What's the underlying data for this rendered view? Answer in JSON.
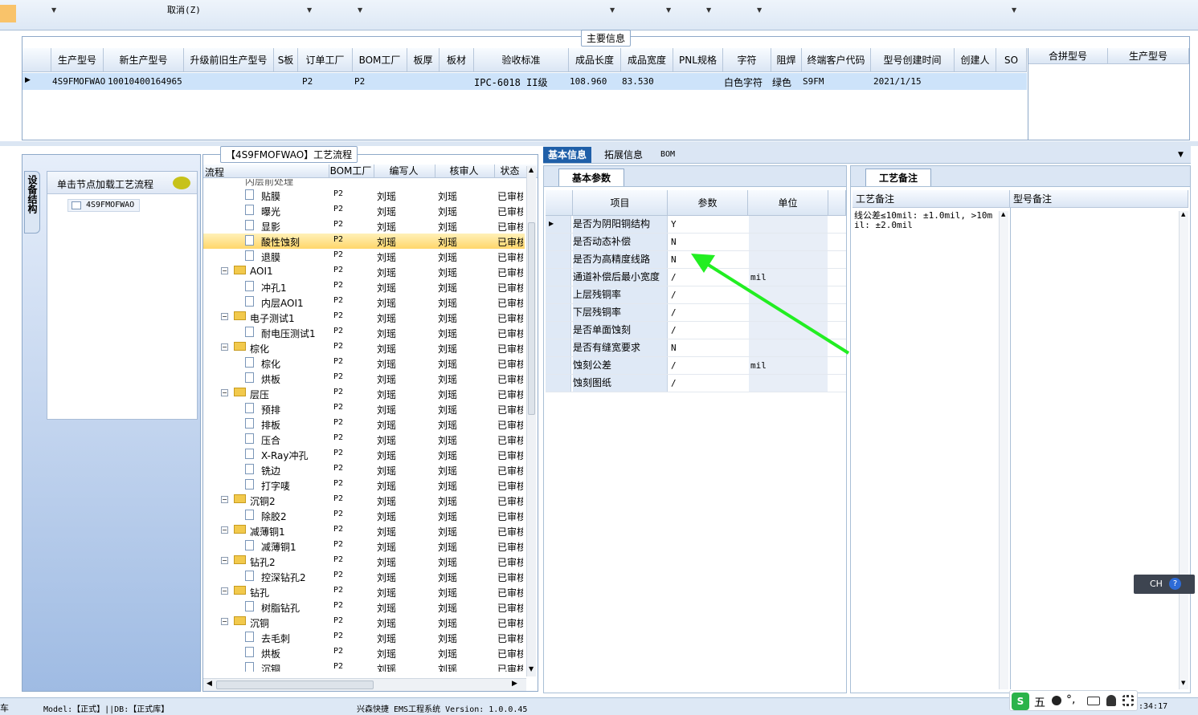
{
  "toolbar": {
    "cancel_label": "取消(Z)"
  },
  "main_info": {
    "legend": "主要信息",
    "columns": [
      "生产型号",
      "新生产型号",
      "升级前旧生产型号",
      "S板",
      "订单工厂",
      "BOM工厂",
      "板厚",
      "板材",
      "验收标准",
      "成品长度",
      "成品宽度",
      "PNL规格",
      "字符",
      "阻焊",
      "终端客户代码",
      "型号创建时间",
      "创建人",
      "SO"
    ],
    "row": {
      "生产型号": "4S9FMOFWAO",
      "新生产型号": "10010400164965",
      "订单工厂": "P2",
      "BOM工厂": "P2",
      "验收标准": "IPC-6018 II级",
      "成品长度": "108.960",
      "成品宽度": "83.530",
      "字符": "白色字符",
      "阻焊": "绿色",
      "终端客户代码": "S9FM",
      "型号创建时间": "2021/1/15"
    },
    "merge_columns": [
      "合拼型号",
      "生产型号"
    ]
  },
  "left_panel": {
    "vertical_tab": "设备结构",
    "header": "单击节点加载工艺流程",
    "tree_node": "4S9FMOFWAO"
  },
  "flow": {
    "legend": "【4S9FMOFWAO】工艺流程",
    "columns": [
      "流程",
      "BOM工厂",
      "编写人",
      "核审人",
      "状态"
    ],
    "partial_top": "内层前处理",
    "rows": [
      {
        "name": "贴膜",
        "type": "doc"
      },
      {
        "name": "曝光",
        "type": "doc"
      },
      {
        "name": "显影",
        "type": "doc"
      },
      {
        "name": "酸性蚀刻",
        "type": "doc",
        "selected": true
      },
      {
        "name": "退膜",
        "type": "doc"
      },
      {
        "name": "AOI1",
        "type": "folder"
      },
      {
        "name": "冲孔1",
        "type": "doc"
      },
      {
        "name": "内层AOI1",
        "type": "doc"
      },
      {
        "name": "电子测试1",
        "type": "folder"
      },
      {
        "name": "耐电压测试1",
        "type": "doc"
      },
      {
        "name": "棕化",
        "type": "folder"
      },
      {
        "name": "棕化",
        "type": "doc"
      },
      {
        "name": "烘板",
        "type": "doc"
      },
      {
        "name": "层压",
        "type": "folder"
      },
      {
        "name": "预排",
        "type": "doc"
      },
      {
        "name": "排板",
        "type": "doc"
      },
      {
        "name": "压合",
        "type": "doc"
      },
      {
        "name": "X-Ray冲孔",
        "type": "doc"
      },
      {
        "name": "铣边",
        "type": "doc"
      },
      {
        "name": "打字唛",
        "type": "doc"
      },
      {
        "name": "沉铜2",
        "type": "folder"
      },
      {
        "name": "除胶2",
        "type": "doc"
      },
      {
        "name": "减薄铜1",
        "type": "folder"
      },
      {
        "name": "减薄铜1",
        "type": "doc"
      },
      {
        "name": "钻孔2",
        "type": "folder"
      },
      {
        "name": "控深钻孔2",
        "type": "doc"
      },
      {
        "name": "钻孔",
        "type": "folder"
      },
      {
        "name": "树脂钻孔",
        "type": "doc"
      },
      {
        "name": "沉铜",
        "type": "folder"
      },
      {
        "name": "去毛刺",
        "type": "doc"
      },
      {
        "name": "烘板",
        "type": "doc"
      },
      {
        "name": "沉铜",
        "type": "doc"
      }
    ],
    "bom": "P2",
    "writer": "刘瑶",
    "reviewer": "刘瑶",
    "status": "已审核"
  },
  "detail_tabs": [
    "基本信息",
    "拓展信息",
    "BOM"
  ],
  "basic_params": {
    "title": "基本参数",
    "columns": [
      "项目",
      "参数",
      "单位"
    ],
    "rows": [
      {
        "item": "是否为阴阳铜结构",
        "value": "Y",
        "unit": ""
      },
      {
        "item": "是否动态补偿",
        "value": "N",
        "unit": ""
      },
      {
        "item": "是否为高精度线路",
        "value": "N",
        "unit": ""
      },
      {
        "item": "通道补偿后最小宽度",
        "value": "/",
        "unit": "mil"
      },
      {
        "item": "上层残铜率",
        "value": "/",
        "unit": ""
      },
      {
        "item": "下层残铜率",
        "value": "/",
        "unit": ""
      },
      {
        "item": "是否单面蚀刻",
        "value": "/",
        "unit": ""
      },
      {
        "item": "是否有缝宽要求",
        "value": "N",
        "unit": ""
      },
      {
        "item": "蚀刻公差",
        "value": "/",
        "unit": "mil"
      },
      {
        "item": "蚀刻图纸",
        "value": "/",
        "unit": ""
      }
    ]
  },
  "process_notes": {
    "title": "工艺备注",
    "columns": [
      "工艺备注",
      "型号备注"
    ],
    "note": "线公差≤10mil: ±1.0mil, >10mil: ±2.0mil"
  },
  "ime": {
    "lang": "CH",
    "mode": "五"
  },
  "status_bar": {
    "left": "Model:【正式】||DB:【正式库】",
    "center": "兴森快捷 EMS工程系统 Version: 1.0.0.45",
    "time": ":34:17",
    "left_edge": "车"
  },
  "colors": {
    "accent": "#1f5fa8",
    "selection": "#cde3fa",
    "arrow": "#22ee22"
  }
}
